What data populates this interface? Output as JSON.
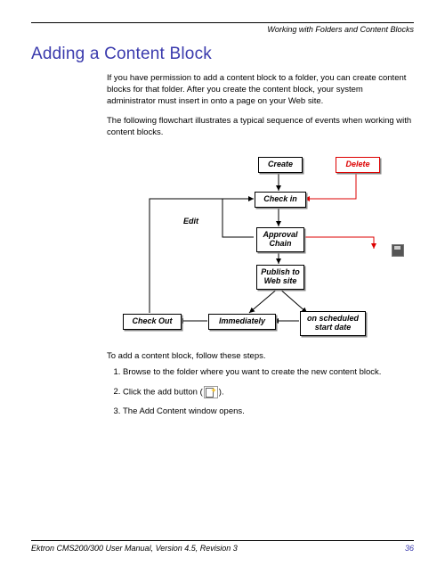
{
  "header": {
    "section": "Working with Folders and Content Blocks"
  },
  "title": "Adding a Content Block",
  "paragraphs": {
    "p1": "If you have permission to add a content block to a folder, you can create content blocks for that folder. After you create the content block, your system administrator must insert in onto a page on your Web site.",
    "p2": "The following flowchart illustrates a typical sequence of events when working with content blocks."
  },
  "flowchart": {
    "create": "Create",
    "delete": "Delete",
    "check_in": "Check in",
    "edit": "Edit",
    "approval_chain": "Approval Chain",
    "publish": "Publish to Web site",
    "check_out": "Check Out",
    "immediately": "Immediately",
    "scheduled": "on scheduled start date"
  },
  "steps_intro": "To add a content block, follow these steps.",
  "steps": {
    "s1": "Browse to the folder where you want to create the new content block.",
    "s2a": "Click the add button (",
    "s2b": ").",
    "s3": "The Add Content window opens."
  },
  "footer": {
    "left": "Ektron CMS200/300 User Manual, Version 4.5, Revision 3",
    "page": "36"
  }
}
